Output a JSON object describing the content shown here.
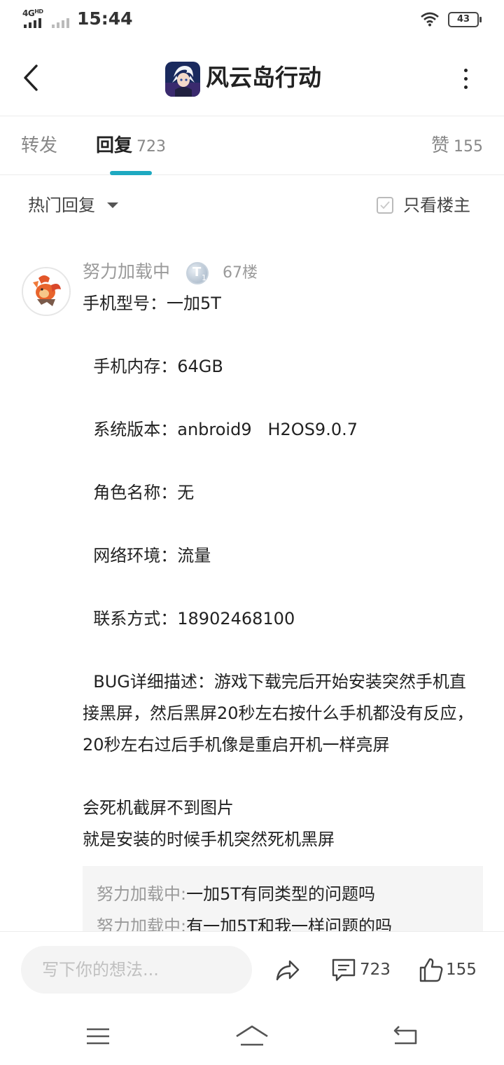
{
  "status_bar": {
    "network": "4G",
    "network_suffix": "HD",
    "time": "15:44",
    "battery": "43"
  },
  "header": {
    "title": "风云岛行动",
    "back_icon": "chevron-left-icon",
    "more_icon": "more-vertical-icon"
  },
  "tabs": [
    {
      "label": "转发",
      "count": ""
    },
    {
      "label": "回复",
      "count": "723"
    },
    {
      "label": "赞",
      "count": "155"
    }
  ],
  "sort": {
    "label": "热门回复",
    "filter_label": "只看楼主"
  },
  "comment": {
    "username": "努力加载中",
    "level": "T",
    "level_num": "1",
    "floor": "67楼",
    "lines": [
      "手机型号：一加5T",
      "  手机内存：64GB",
      "  系统版本：anbroid9   H2OS9.0.7",
      "  角色名称：无",
      "  网络环境：流量",
      "  联系方式：18902468100",
      "  BUG详细描述：游戏下载完后开始安装突然手机直接黑屏，然后黑屏20秒左右按什么手机都没有反应，20秒左右过后手机像是重启开机一样亮屏",
      "会死机截屏不到图片",
      "就是安装的时候手机突然死机黑屏"
    ],
    "replies": [
      {
        "user": "努力加载中",
        "text": "一加5T有同类型的问题吗"
      },
      {
        "user": "努力加载中",
        "text": "有一加5T和我一样问题的吗"
      }
    ]
  },
  "action_bar": {
    "input_placeholder": "写下你的想法...",
    "comment_count": "723",
    "like_count": "155"
  },
  "colors": {
    "accent": "#1ea9c1",
    "muted_text": "#9a9a9a",
    "reply_background": "#f5f5f5"
  }
}
